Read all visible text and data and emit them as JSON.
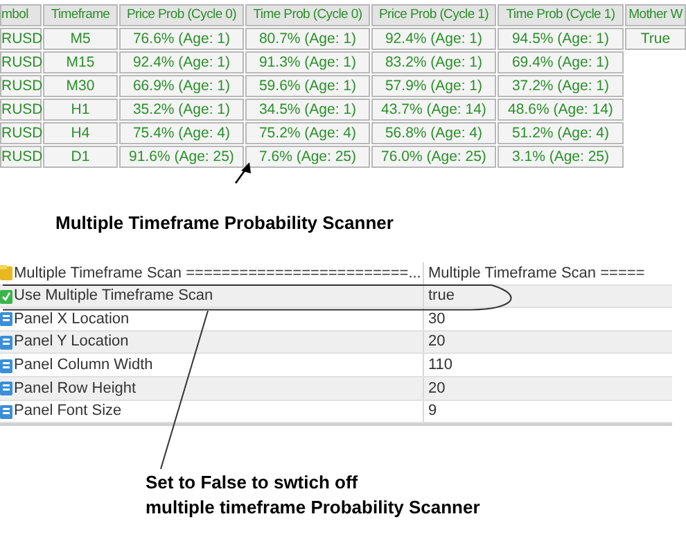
{
  "scanner_table": {
    "columns": [
      "mbol",
      "Timeframe",
      "Price Prob (Cycle 0)",
      "Time Prob (Cycle 0)",
      "Price Prob (Cycle 1)",
      "Time Prob (Cycle 1)",
      "Mother W"
    ],
    "rows": [
      [
        "RUSD",
        "M5",
        "76.6%  (Age: 1)",
        "80.7% (Age: 1)",
        "92.4%  (Age: 1)",
        "94.5% (Age: 1)",
        "True"
      ],
      [
        "RUSD",
        "M15",
        "92.4%  (Age: 1)",
        "91.3% (Age: 1)",
        "83.2%  (Age: 1)",
        "69.4% (Age: 1)"
      ],
      [
        "RUSD",
        "M30",
        "66.9%  (Age: 1)",
        "59.6% (Age: 1)",
        "57.9%  (Age: 1)",
        "37.2% (Age: 1)"
      ],
      [
        "RUSD",
        "H1",
        "35.2%  (Age: 1)",
        "34.5% (Age: 1)",
        "43.7%  (Age: 14)",
        "48.6% (Age: 14)"
      ],
      [
        "RUSD",
        "H4",
        "75.4%  (Age: 4)",
        "75.2% (Age: 4)",
        "56.8%  (Age: 4)",
        "51.2% (Age: 4)"
      ],
      [
        "RUSD",
        "D1",
        "91.6%  (Age: 25)",
        "7.6% (Age: 25)",
        "76.0%  (Age: 25)",
        "3.1% (Age: 25)"
      ]
    ]
  },
  "scanner_caption": "Multiple Timeframe Probability Scanner",
  "settings": [
    {
      "kind": "group",
      "name": "Multiple Timeframe Scan =========================...",
      "value": "Multiple Timeframe Scan ====="
    },
    {
      "kind": "bool",
      "name": "Use Multiple Timeframe Scan",
      "value": "true"
    },
    {
      "kind": "int",
      "name": "Panel X Location",
      "value": "30"
    },
    {
      "kind": "int",
      "name": "Panel Y Location",
      "value": "20"
    },
    {
      "kind": "int",
      "name": "Panel Column Width",
      "value": "110"
    },
    {
      "kind": "int",
      "name": "Panel Row Height",
      "value": "20"
    },
    {
      "kind": "int",
      "name": "Panel Font Size",
      "value": "9"
    }
  ],
  "note": [
    "Set to False to swtich off",
    "multiple timeframe Probability Scanner"
  ]
}
